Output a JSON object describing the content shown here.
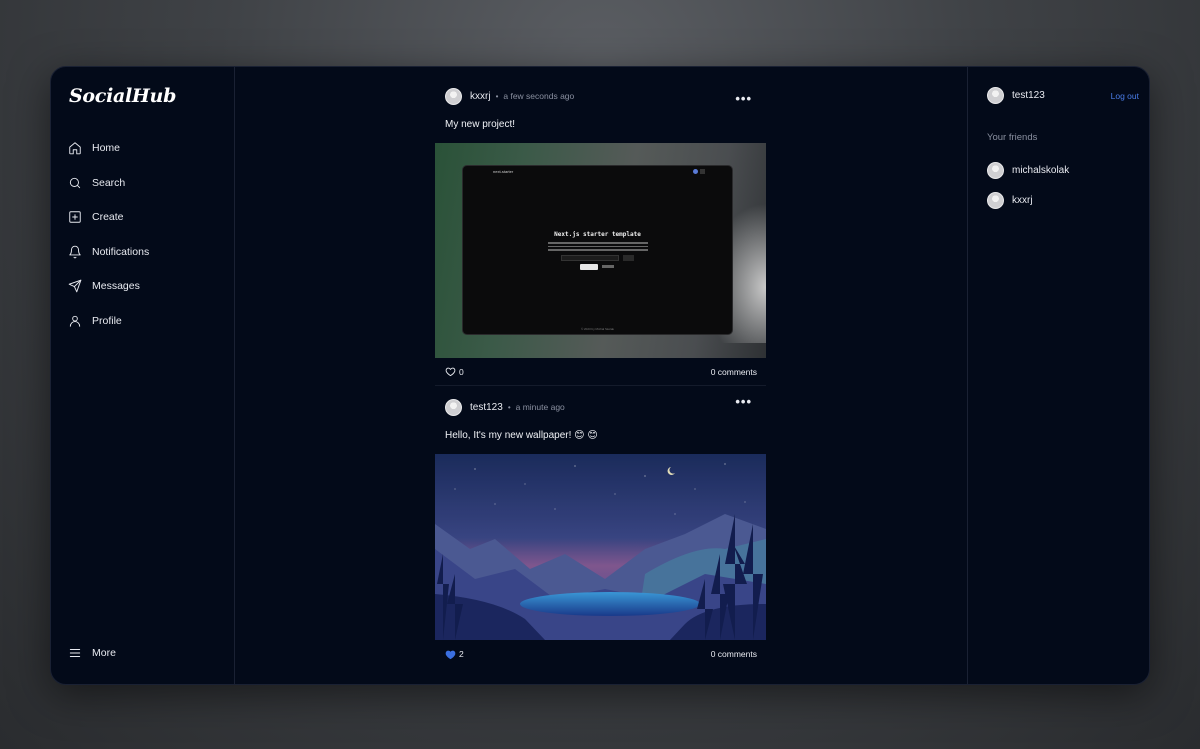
{
  "app": {
    "logo": "SocialHub"
  },
  "nav": {
    "items": [
      {
        "label": "Home",
        "icon": "home-icon"
      },
      {
        "label": "Search",
        "icon": "search-icon"
      },
      {
        "label": "Create",
        "icon": "plus-square-icon"
      },
      {
        "label": "Notifications",
        "icon": "bell-icon"
      },
      {
        "label": "Messages",
        "icon": "send-icon"
      },
      {
        "label": "Profile",
        "icon": "user-icon"
      }
    ],
    "more": {
      "label": "More",
      "icon": "menu-icon"
    }
  },
  "posts": [
    {
      "user": "kxxrj",
      "time": "a few seconds ago",
      "text": "My new project!",
      "likes": "0",
      "liked": false,
      "comments": "0 comments",
      "image": {
        "title": "Next.js starter template",
        "window_title": "next-starter",
        "footer": "© 2023 by Michal Skolak"
      }
    },
    {
      "user": "test123",
      "time": "a minute ago",
      "text": "Hello, It's my new wallpaper! 😊 😊",
      "likes": "2",
      "liked": true,
      "comments": "0 comments",
      "image": {}
    }
  ],
  "right": {
    "current_user": "test123",
    "logout": "Log out",
    "friends_title": "Your friends",
    "friends": [
      "michalskolak",
      "kxxrj"
    ]
  },
  "colors": {
    "background": "#030a19",
    "accent": "#4a7de8",
    "like_filled": "#3b6fe0"
  }
}
